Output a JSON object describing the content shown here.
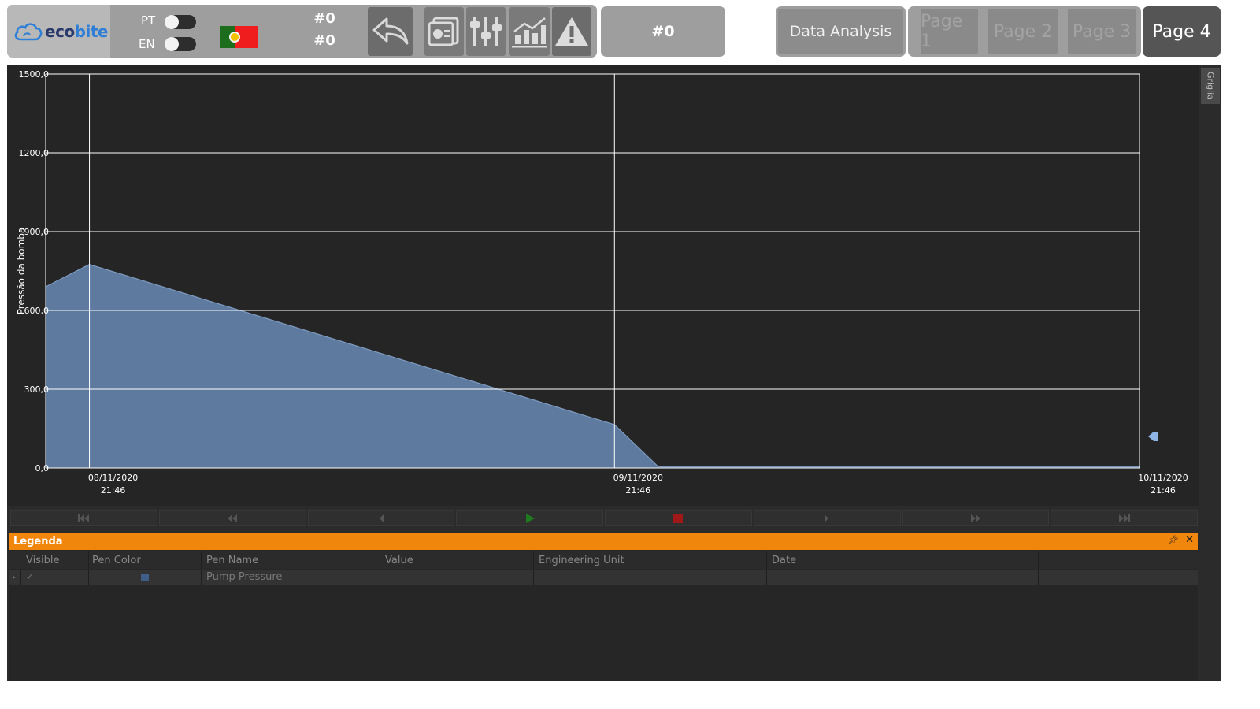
{
  "header": {
    "logo": {
      "eco": "eco",
      "bite": "bite"
    },
    "language": {
      "pt_label": "PT",
      "en_label": "EN"
    },
    "counters": [
      "#0",
      "#0"
    ],
    "counter_box": "#0",
    "icons": [
      "back-arrow-icon",
      "report-icon",
      "sliders-icon",
      "chart-icon",
      "warning-icon"
    ]
  },
  "navigation": {
    "data_analysis": "Data Analysis",
    "pages": [
      "Page 1",
      "Page 2",
      "Page 3"
    ],
    "active_page": "Page 4"
  },
  "side_tab": "Griglia",
  "chart_data": {
    "type": "area",
    "ylabel": "Pressão da bomba",
    "ylim": [
      0,
      1500
    ],
    "y_ticks": [
      "0,0",
      "300,0",
      "600,0",
      "900,0",
      "1200,0",
      "1500,0"
    ],
    "x_ticks": [
      {
        "date": "08/11/2020",
        "time": "21:46"
      },
      {
        "date": "09/11/2020",
        "time": "21:46"
      },
      {
        "date": "10/11/2020",
        "time": "21:46"
      }
    ],
    "series": [
      {
        "name": "Pump Pressure",
        "color": "#5e7a9e",
        "points": [
          {
            "x": "08/11/2020 19:46",
            "y": 690
          },
          {
            "x": "08/11/2020 21:46",
            "y": 775
          },
          {
            "x": "09/11/2020 21:46",
            "y": 165
          },
          {
            "x": "09/11/2020 23:46",
            "y": 5
          },
          {
            "x": "10/11/2020 21:46",
            "y": 5
          }
        ]
      }
    ]
  },
  "controls": [
    "first",
    "fast-back",
    "back",
    "play",
    "stop",
    "forward",
    "fast-forward",
    "last"
  ],
  "legend": {
    "title": "Legenda",
    "columns": [
      "Visible",
      "Pen Color",
      "Pen Name",
      "Value",
      "Engineering Unit",
      "Date"
    ],
    "rows": [
      {
        "visible": "✓",
        "pen_color": "#3f5f8a",
        "pen_name": "Pump Pressure",
        "value": "",
        "unit": "",
        "date": ""
      }
    ]
  }
}
